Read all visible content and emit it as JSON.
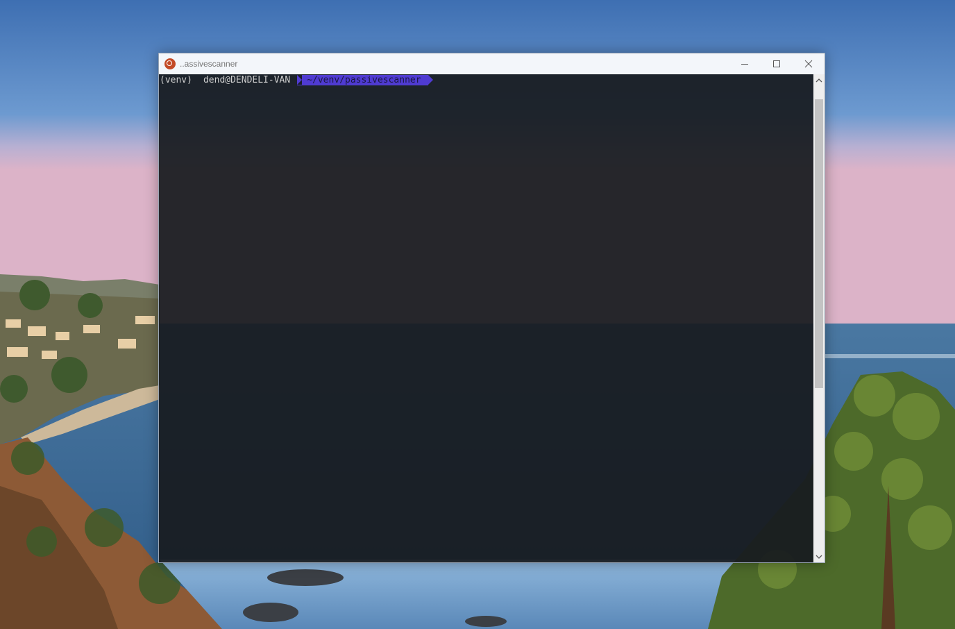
{
  "desktop": {
    "wallpaper": "coastal-cliff-sunset"
  },
  "window": {
    "title": "..assivescanner",
    "icon": "ubuntu-icon",
    "controls": {
      "minimize": "minimize-icon",
      "maximize": "maximize-icon",
      "close": "close-icon"
    }
  },
  "terminal": {
    "prompt": {
      "venv": "(venv)",
      "user_host": "dend@DENDELI-VAN",
      "path": "~/venv/passivescanner"
    },
    "colors": {
      "background": "#181b1f",
      "text": "#cfcfcf",
      "path_segment": "#4f3bd1"
    }
  }
}
